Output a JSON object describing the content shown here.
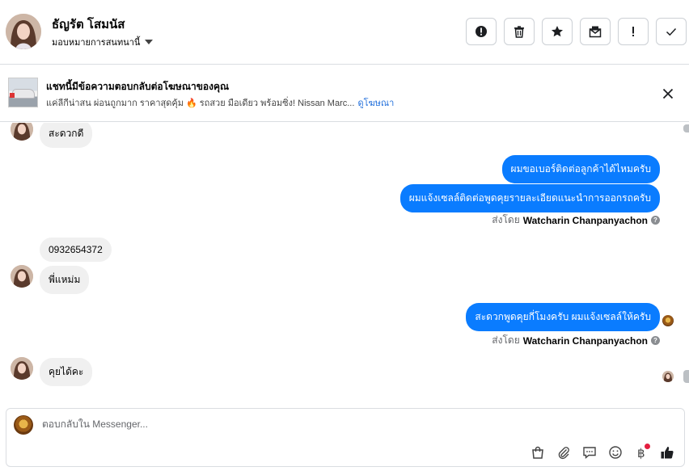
{
  "contact": {
    "name": "ธัญรัต โสมนัส",
    "assign_label": "มอบหมายการสนทนานี้"
  },
  "header_actions": [
    {
      "name": "report-icon",
      "label": "!"
    },
    {
      "name": "trash-icon"
    },
    {
      "name": "star-icon"
    },
    {
      "name": "mark-unread-icon"
    },
    {
      "name": "exclamation-icon",
      "label": "!"
    },
    {
      "name": "check-icon"
    }
  ],
  "ad": {
    "title": "แชทนี้มีข้อความตอบกลับต่อโฆษณาของคุณ",
    "subtitle": "แค่ลีกีน่าสน ผ่อนถูกมาก ราคาสุดคุ้ม 🔥 รถสวย มือเดียว พร้อมซิ่ง! Nissan Marc...",
    "link": "ดูโฆษณา"
  },
  "messages": {
    "m1": "สะดวกดี",
    "m2": "ผมขอเบอร์ติดต่อลูกค้าได้ไหมครับ",
    "m3": "ผมแจ้งเซลล์ติดต่อพูดคุยรายละเอียดแนะนำการออกรถครับ",
    "m4": "0932654372",
    "m5": "พี่แหม่ม",
    "m6": "สะดวกพูดคุยกี่โมงครับ ผมแจ้งเซลล์ให้ครับ",
    "m7": "คุยได้คะ"
  },
  "sent_by": {
    "prefix": "ส่งโดย",
    "agent": "Watcharin Chanpanyachon"
  },
  "composer": {
    "placeholder": "ตอบกลับใน Messenger..."
  },
  "toolbar_icons": [
    "shopping-bag-icon",
    "paperclip-icon",
    "saved-reply-icon",
    "emoji-icon",
    "payment-icon",
    "like-icon"
  ],
  "colors": {
    "outgoing_bubble": "#0a7cff",
    "incoming_bubble": "#f0f0f0",
    "link": "#216fdb",
    "notification_dot": "#e41e3f"
  }
}
